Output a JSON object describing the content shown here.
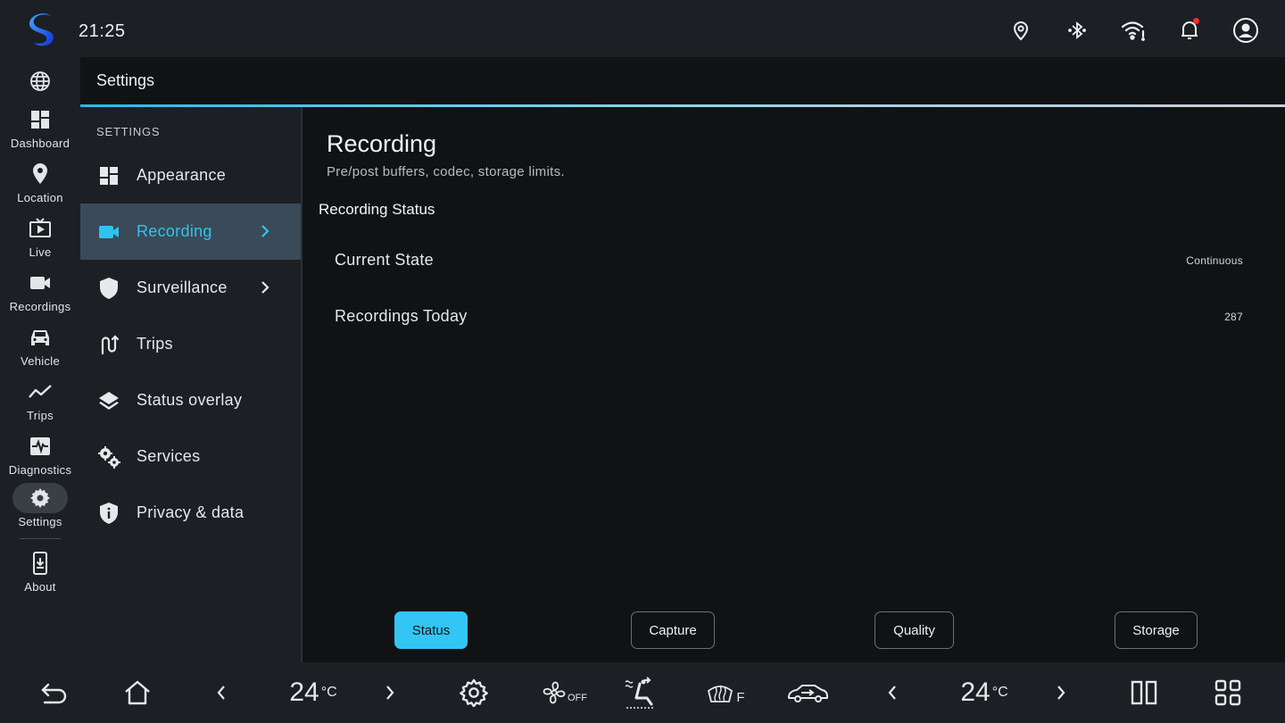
{
  "status_bar": {
    "time": "21:25",
    "icons": [
      "location-pin-icon",
      "bluetooth-icon",
      "wifi-icon",
      "bell-icon",
      "account-icon"
    ],
    "notification_dot_color": "#ff2a2a"
  },
  "rail": {
    "items": [
      {
        "icon": "globe-icon",
        "label": ""
      },
      {
        "icon": "dashboard-icon",
        "label": "Dashboard"
      },
      {
        "icon": "location-pin-icon",
        "label": "Location"
      },
      {
        "icon": "tv-icon",
        "label": "Live"
      },
      {
        "icon": "videocam-icon",
        "label": "Recordings"
      },
      {
        "icon": "car-icon",
        "label": "Vehicle"
      },
      {
        "icon": "trend-line-icon",
        "label": "Trips"
      },
      {
        "icon": "monitor-heart-icon",
        "label": "Diagnostics"
      },
      {
        "icon": "gear-icon",
        "label": "Settings"
      },
      {
        "icon": "phone-download-icon",
        "label": "About"
      }
    ],
    "active": "Settings"
  },
  "header": {
    "title": "Settings",
    "accent_color": "#2bb8e8"
  },
  "menu": {
    "heading": "SETTINGS",
    "items": [
      {
        "icon": "dashboard-icon",
        "label": "Appearance"
      },
      {
        "icon": "videocam-icon",
        "label": "Recording"
      },
      {
        "icon": "shield-icon",
        "label": "Surveillance"
      },
      {
        "icon": "route-icon",
        "label": "Trips"
      },
      {
        "icon": "layers-icon",
        "label": "Status overlay"
      },
      {
        "icon": "gears-icon",
        "label": "Services"
      },
      {
        "icon": "shield-info-icon",
        "label": "Privacy & data"
      }
    ],
    "active": "Recording",
    "active_color": "#2fc3f0"
  },
  "content": {
    "title": "Recording",
    "subtitle": "Pre/post buffers, codec, storage limits.",
    "section_title": "Recording Status",
    "rows": [
      {
        "label": "Current State",
        "value": "Continuous"
      },
      {
        "label": "Recordings Today",
        "value": "287"
      }
    ],
    "tabs": [
      {
        "label": "Status"
      },
      {
        "label": "Capture"
      },
      {
        "label": "Quality"
      },
      {
        "label": "Storage"
      }
    ],
    "active_tab": "Status",
    "active_tab_color": "#33c6f5"
  },
  "bottom_bar": {
    "left_temp": "24",
    "right_temp": "24",
    "temp_unit": "°C",
    "fan_label": "OFF",
    "defrost_label": "F",
    "icons": [
      "back-icon",
      "home-icon",
      "chevron-left-icon",
      "chevron-right-icon",
      "gear-icon",
      "fan-icon",
      "seat-airflow-icon",
      "rear-defrost-icon",
      "car-recirculation-icon",
      "chevron-left-icon",
      "chevron-right-icon",
      "split-screen-icon",
      "apps-grid-icon"
    ]
  }
}
